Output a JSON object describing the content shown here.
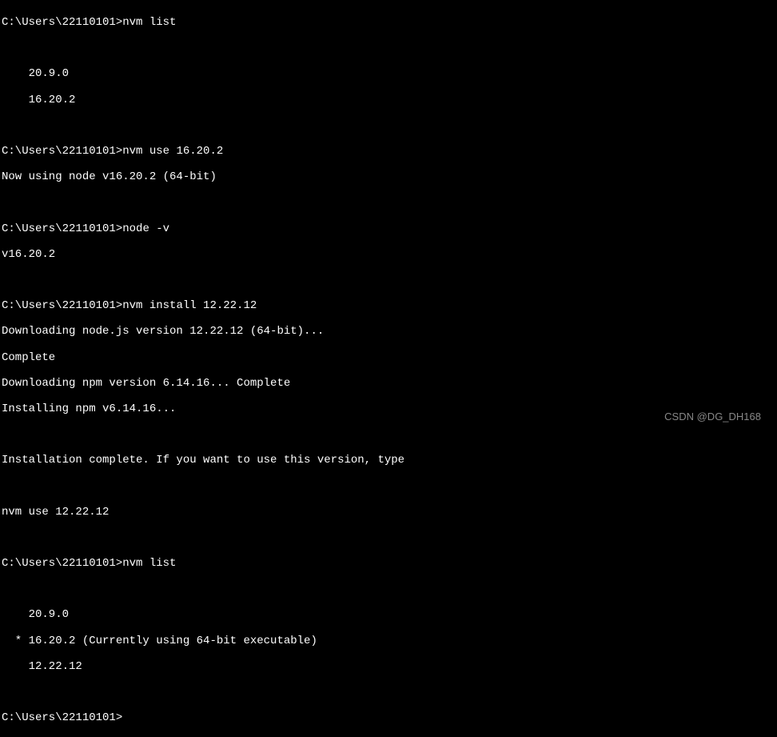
{
  "terminal": {
    "prompt": "C:\\Users\\22110101>",
    "commands": {
      "nvm_list_1": "nvm list",
      "nvm_use": "nvm use 16.20.2",
      "node_v": "node -v",
      "nvm_install": "nvm install 12.22.12",
      "nvm_list_2": "nvm list"
    },
    "output": {
      "list1_line1": "    20.9.0",
      "list1_line2": "    16.20.2",
      "use_result": "Now using node v16.20.2 (64-bit)",
      "node_version": "v16.20.2",
      "install_line1": "Downloading node.js version 12.22.12 (64-bit)...",
      "install_line2": "Complete",
      "install_line3": "Downloading npm version 6.14.16... Complete",
      "install_line4": "Installing npm v6.14.16...",
      "install_line5": "Installation complete. If you want to use this version, type",
      "install_line6": "nvm use 12.22.12",
      "list2_line1": "    20.9.0",
      "list2_line2": "  * 16.20.2 (Currently using 64-bit executable)",
      "list2_line3": "    12.22.12"
    }
  },
  "watermark": "CSDN @DG_DH168"
}
